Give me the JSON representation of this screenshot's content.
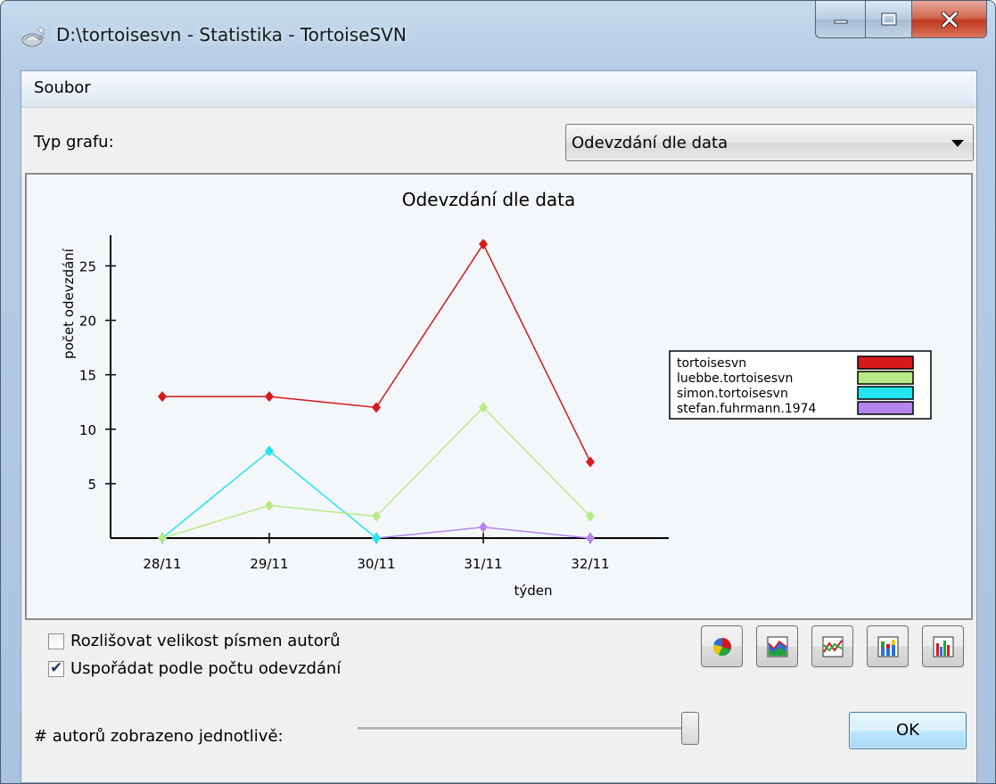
{
  "window": {
    "title": "D:\\tortoisesvn - Statistika - TortoiseSVN"
  },
  "menu": {
    "file": "Soubor"
  },
  "graph_type": {
    "label": "Typ grafu:",
    "selected": "Odevzdání dle data"
  },
  "options": {
    "case_sensitive": {
      "label": "Rozlišovat velikost písmen autorů",
      "checked": false
    },
    "sort_by_commits": {
      "label": "Uspořádat podle počtu odevzdání",
      "checked": true
    }
  },
  "authors_slider": {
    "label": "# autorů zobrazeno jednotlivě:",
    "value": 1.0
  },
  "ok_label": "OK",
  "toolbar_icons": [
    "pie-chart-icon",
    "stacked-area-chart-icon",
    "line-chart-icon",
    "stacked-bar-chart-icon",
    "bar-chart-icon"
  ],
  "chart_data": {
    "type": "line",
    "title": "Odevzdání dle data",
    "xlabel": "týden",
    "ylabel": "počet odevzdání",
    "categories": [
      "28/11",
      "29/11",
      "30/11",
      "31/11",
      "32/11"
    ],
    "ylim": [
      0,
      27
    ],
    "yticks": [
      5,
      10,
      15,
      20,
      25
    ],
    "legend_position": "right",
    "series": [
      {
        "name": "tortoisesvn",
        "color": "#d7191c",
        "values": [
          13,
          13,
          12,
          27,
          7
        ]
      },
      {
        "name": "luebbe.tortoisesvn",
        "color": "#b8e986",
        "values": [
          0,
          3,
          2,
          12,
          2
        ]
      },
      {
        "name": "simon.tortoisesvn",
        "color": "#22e5f0",
        "values": [
          0,
          8,
          0,
          null,
          null
        ]
      },
      {
        "name": "stefan.fuhrmann.1974",
        "color": "#b685ec",
        "values": [
          null,
          null,
          0,
          1,
          0
        ]
      }
    ]
  }
}
